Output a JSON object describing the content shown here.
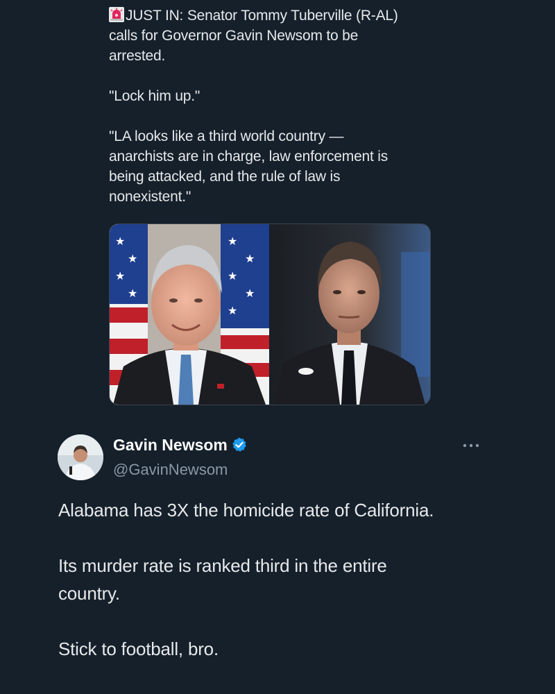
{
  "quoted_tweet": {
    "headline_icon": "siren-icon",
    "lines": [
      "JUST IN: Senator Tommy Tuberville (R-AL)",
      "calls for Governor Gavin Newsom to be",
      "arrested.",
      "\"Lock him up.\"",
      "\"LA looks like a third world country —",
      "anarchists are in charge, law enforcement is",
      "being attacked, and the rule of law is",
      "nonexistent.\""
    ],
    "media": {
      "left_photo": "tuberville-photo",
      "right_photo": "newsom-photo"
    }
  },
  "reply_tweet": {
    "display_name": "Gavin Newsom",
    "verified": true,
    "handle": "@GavinNewsom",
    "lines": [
      "Alabama has 3X the homicide rate of California.",
      "Its murder rate is ranked third in the entire",
      "country.",
      "Stick to football, bro."
    ]
  },
  "colors": {
    "background": "#15202b",
    "text": "#e7e9ea",
    "secondary_text": "#8b98a5",
    "verified_blue": "#1d9bf0"
  }
}
